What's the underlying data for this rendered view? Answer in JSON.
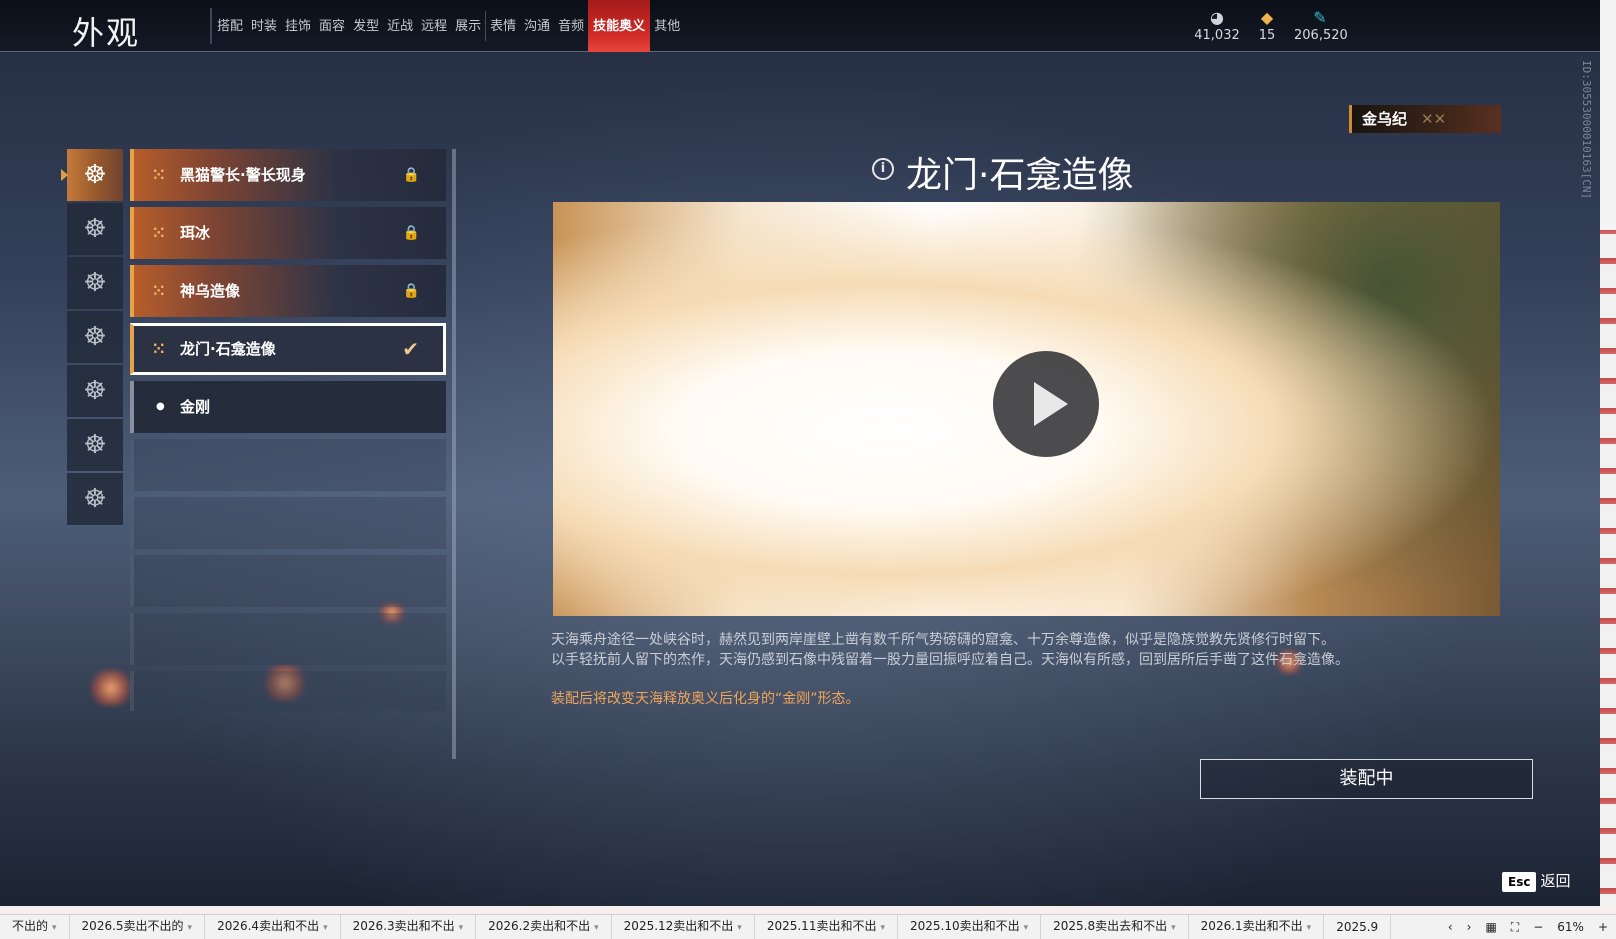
{
  "header": {
    "title": "外观",
    "tabs": [
      "搭配",
      "时装",
      "挂饰",
      "面容",
      "发型",
      "近战",
      "远程",
      "展示",
      "表情",
      "沟通",
      "音频",
      "技能奥义",
      "其他"
    ],
    "active_tab": "技能奥义",
    "currencies": [
      {
        "icon": "coin-stack-icon",
        "value": "41,032"
      },
      {
        "icon": "ticket-icon",
        "value": "15"
      },
      {
        "icon": "feather-icon",
        "value": "206,520"
      }
    ]
  },
  "side_id": "ID:3055300001016\u00063[CN]",
  "badge": {
    "label": "金乌纪",
    "deco": "✕✕"
  },
  "categories": [
    {
      "icon": "figure-icon-1",
      "glyph": "☸"
    },
    {
      "icon": "figure-icon-2",
      "glyph": "☸"
    },
    {
      "icon": "figure-icon-3",
      "glyph": "☸"
    },
    {
      "icon": "figure-icon-4",
      "glyph": "☸"
    },
    {
      "icon": "figure-icon-5",
      "glyph": "☸"
    },
    {
      "icon": "figure-icon-6",
      "glyph": "☸"
    },
    {
      "icon": "figure-icon-7",
      "glyph": "☸"
    }
  ],
  "list": {
    "items": [
      {
        "label": "黑猫警长·警长现身",
        "state": "locked"
      },
      {
        "label": "珥冰",
        "state": "locked"
      },
      {
        "label": "神乌造像",
        "state": "locked"
      },
      {
        "label": "龙门·石龛造像",
        "state": "selected"
      },
      {
        "label": "金刚",
        "state": "plain"
      }
    ],
    "lock_glyph": "🔒",
    "check_glyph": "✔",
    "mark_glyph": "⁙"
  },
  "detail": {
    "title": "龙门·石龛造像",
    "info_glyph": "i",
    "description_1": "天海乘舟途径一处峡谷时，赫然见到两岸崖壁上凿有数千所气势磅礴的窟龛、十万余尊造像，似乎是隐族觉教先贤修行时留下。",
    "description_2": "以手轻抚前人留下的杰作，天海仍感到石像中残留着一股力量回振呼应着自己。天海似有所感，回到居所后手凿了这件石龛造像。",
    "note": "装配后将改变天海释放奥义后化身的“金刚”形态。",
    "equip_button": "装配中"
  },
  "esc": {
    "key": "Esc",
    "label": "返回"
  },
  "taskbar": {
    "sheets": [
      "不出的",
      "2026.5卖出不出的",
      "2026.4卖出和不出",
      "2026.3卖出和不出",
      "2026.2卖出和不出",
      "2025.12卖出和不出",
      "2025.11卖出和不出",
      "2025.10卖出和不出",
      "2025.8卖出去和不出",
      "2026.1卖出和不出",
      "2025.9"
    ],
    "zoom": "61%"
  },
  "colors": {
    "accent_red": "#d32c27",
    "accent_orange": "#e8a34a",
    "note_orange": "#f0a55a"
  }
}
